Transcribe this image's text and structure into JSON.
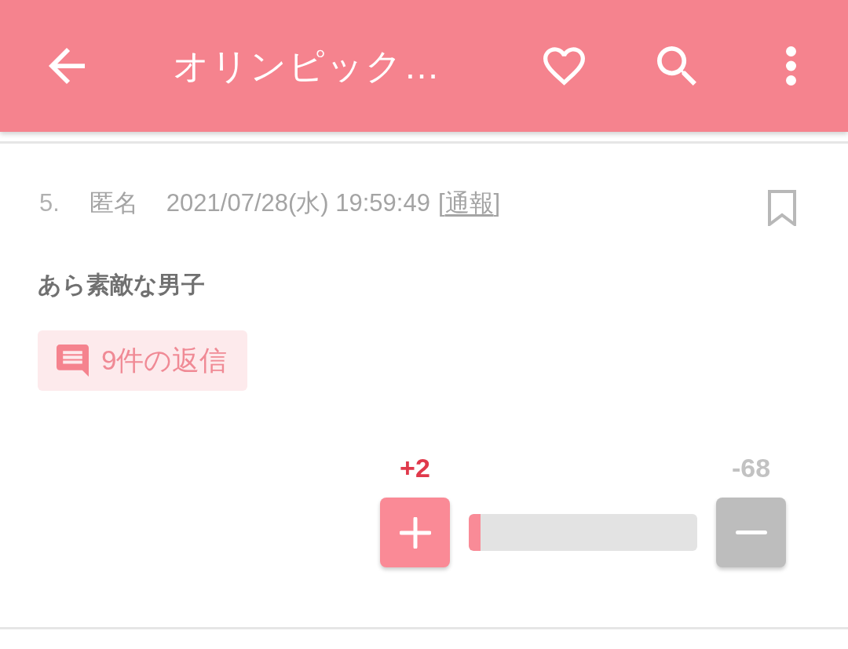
{
  "app_bar": {
    "title": "オリンピック…"
  },
  "comment": {
    "number": "5.",
    "author": "匿名",
    "datetime": "2021/07/28(水) 19:59:49",
    "report_link": {
      "open": "[",
      "label": "通報",
      "close": "]"
    },
    "bookmarked": false,
    "body": "あら素敵な男子",
    "replies": "9件の返信",
    "votes": {
      "plus": "+2",
      "minus": "-68",
      "level": 0.05
    }
  }
}
